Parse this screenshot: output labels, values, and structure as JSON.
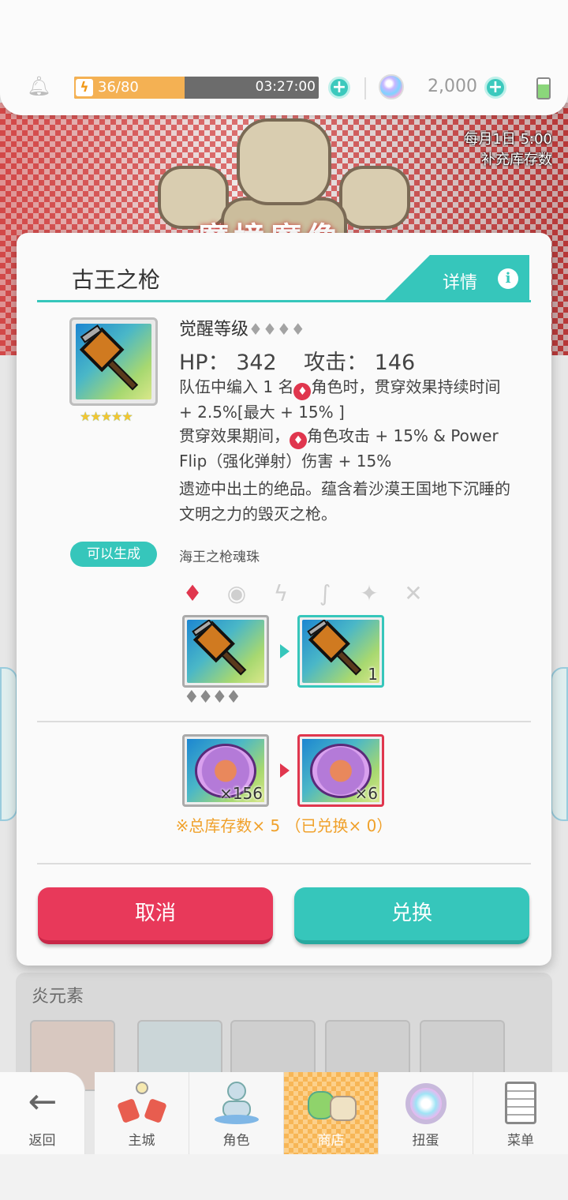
{
  "topbar": {
    "stamina": "36/80",
    "stamina_fraction": 0.45,
    "timer": "03:27:00",
    "gems": "2,000"
  },
  "banner": {
    "note_line1": "每月1日 5:00",
    "note_line2": "补充库存数",
    "title": "魔境魔像"
  },
  "modal": {
    "title": "古王之枪",
    "detail_label": "详情",
    "awaken_label": "觉醒等级",
    "awaken_diamonds": "♦♦♦♦",
    "hp_label": "HP：",
    "hp_value": "342",
    "atk_label": "攻击：",
    "atk_value": "146",
    "effect_1a": "队伍中编入 1 名",
    "effect_1b": "角色时，贯穿效果持续时间 + 2.5%[最大 + 15% ]",
    "effect_2a": "贯穿效果期间，",
    "effect_2b": "角色攻击 + 15% & Power Flip（强化弹射）伤害 + 15%",
    "lore": "遗迹中出土的绝品。蕴含着沙漠王国地下沉睡的文明之力的毁灭之枪。",
    "can_generate": "可以生成",
    "soul_orb_name": "海王之枪魂珠",
    "target_count": "1",
    "source_diamonds": "♦♦♦♦",
    "orb_owned": "×156",
    "orb_cost": "×6",
    "stock_note": "※总库存数× 5 （已兑换× 0）",
    "cancel": "取消",
    "exchange": "兑换"
  },
  "background": {
    "section_label": "炎元素"
  },
  "nav": {
    "back": "返回",
    "home": "主城",
    "characters": "角色",
    "shop": "商店",
    "gacha": "扭蛋",
    "menu": "菜单"
  },
  "colors": {
    "accent": "#36c6bb",
    "cancel": "#e8395a",
    "stamina": "#f4b153",
    "warning_text": "#f0a12b"
  }
}
